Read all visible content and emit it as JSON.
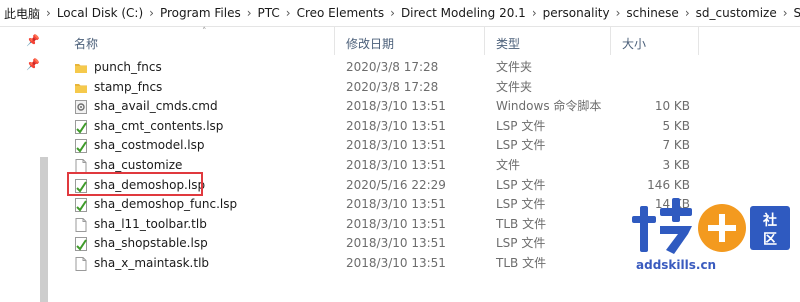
{
  "breadcrumb": [
    "此电脑",
    "Local Disk (C:)",
    "Program Files",
    "PTC",
    "Creo Elements",
    "Direct Modeling 20.1",
    "personality",
    "schinese",
    "sd_customize",
    "SheetAdvisor"
  ],
  "columns": {
    "name": "名称",
    "date": "修改日期",
    "type": "类型",
    "size": "大小"
  },
  "files": [
    {
      "name": "punch_fncs",
      "date": "2020/3/8 17:28",
      "type": "文件夹",
      "size": "",
      "icon": "folder-icon"
    },
    {
      "name": "stamp_fncs",
      "date": "2020/3/8 17:28",
      "type": "文件夹",
      "size": "",
      "icon": "folder-icon"
    },
    {
      "name": "sha_avail_cmds.cmd",
      "date": "2018/3/10 13:51",
      "type": "Windows 命令脚本",
      "size": "10 KB",
      "icon": "cmd-file-icon"
    },
    {
      "name": "sha_cmt_contents.lsp",
      "date": "2018/3/10 13:51",
      "type": "LSP 文件",
      "size": "5 KB",
      "icon": "lsp-file-icon"
    },
    {
      "name": "sha_costmodel.lsp",
      "date": "2018/3/10 13:51",
      "type": "LSP 文件",
      "size": "7 KB",
      "icon": "lsp-file-icon"
    },
    {
      "name": "sha_customize",
      "date": "2018/3/10 13:51",
      "type": "文件",
      "size": "3 KB",
      "icon": "generic-file-icon"
    },
    {
      "name": "sha_demoshop.lsp",
      "date": "2020/5/16 22:29",
      "type": "LSP 文件",
      "size": "146 KB",
      "icon": "lsp-file-icon"
    },
    {
      "name": "sha_demoshop_func.lsp",
      "date": "2018/3/10 13:51",
      "type": "LSP 文件",
      "size": "14 KB",
      "icon": "lsp-file-icon"
    },
    {
      "name": "sha_l11_toolbar.tlb",
      "date": "2018/3/10 13:51",
      "type": "TLB 文件",
      "size": "",
      "icon": "generic-file-icon"
    },
    {
      "name": "sha_shopstable.lsp",
      "date": "2018/3/10 13:51",
      "type": "LSP 文件",
      "size": "",
      "icon": "lsp-file-icon"
    },
    {
      "name": "sha_x_maintask.tlb",
      "date": "2018/3/10 13:51",
      "type": "TLB 文件",
      "size": "",
      "icon": "generic-file-icon"
    }
  ],
  "highlighted_file": "sha_demoshop.lsp",
  "watermark": {
    "site": "addskills.cn",
    "text": "技社区"
  },
  "colors": {
    "highlight": "#e0393e",
    "header_text": "#4c607a",
    "folder": "#e8b53a",
    "lsp_green": "#3f9b2a"
  }
}
